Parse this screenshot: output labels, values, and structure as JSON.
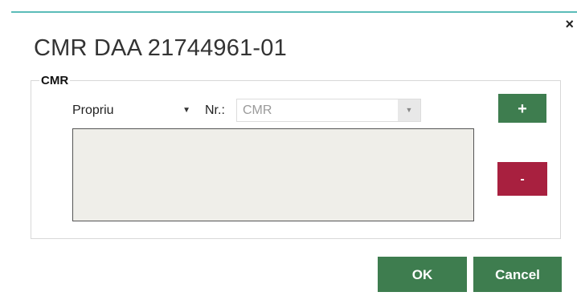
{
  "dialog": {
    "title": "CMR DAA 21744961-01",
    "close_icon": "close-icon",
    "close_glyph": "×"
  },
  "group": {
    "legend": "CMR",
    "type_select": {
      "value": "Propriu",
      "arrow_icon": "dropdown-arrow-icon",
      "arrow_glyph": "▼"
    },
    "nr_label": "Nr.:",
    "nr_select": {
      "value": "CMR",
      "arrow_icon": "dropdown-arrow-icon",
      "arrow_glyph": "▼"
    },
    "list_items": []
  },
  "buttons": {
    "add_label": "+",
    "remove_label": "-",
    "ok_label": "OK",
    "cancel_label": "Cancel"
  },
  "colors": {
    "accent_green": "#3e7d4f",
    "remove_red": "#a8203f",
    "top_edge": "#5bbcb8",
    "list_background": "#efeee9"
  }
}
